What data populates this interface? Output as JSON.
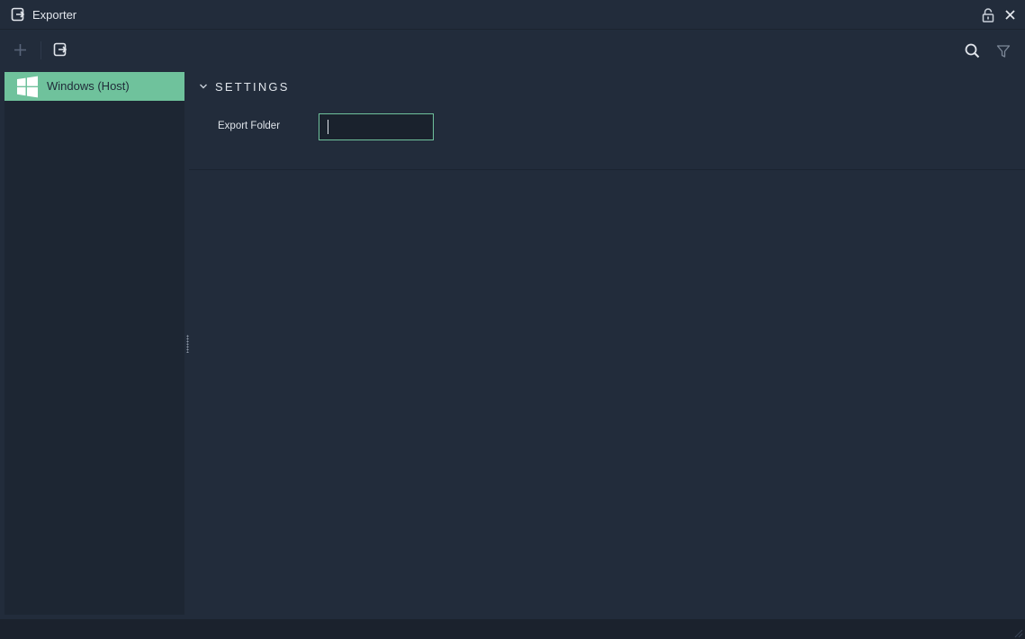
{
  "window": {
    "title": "Exporter",
    "title_icon": "exporter-icon",
    "lock_icon": "lock-icon",
    "close_icon": "close-icon"
  },
  "toolbar": {
    "add_icon": "plus-icon",
    "export_icon": "export-icon",
    "search_icon": "search-icon",
    "filter_icon": "filter-icon"
  },
  "sidebar": {
    "items": [
      {
        "label": "Windows (Host)",
        "icon": "windows-icon",
        "selected": true
      }
    ]
  },
  "settings": {
    "section_title": "SETTINGS",
    "export_folder_label": "Export Folder",
    "export_folder_value": ""
  },
  "colors": {
    "accent": "#6fc29c",
    "background": "#222c3b",
    "sidebar": "#1d2633"
  }
}
